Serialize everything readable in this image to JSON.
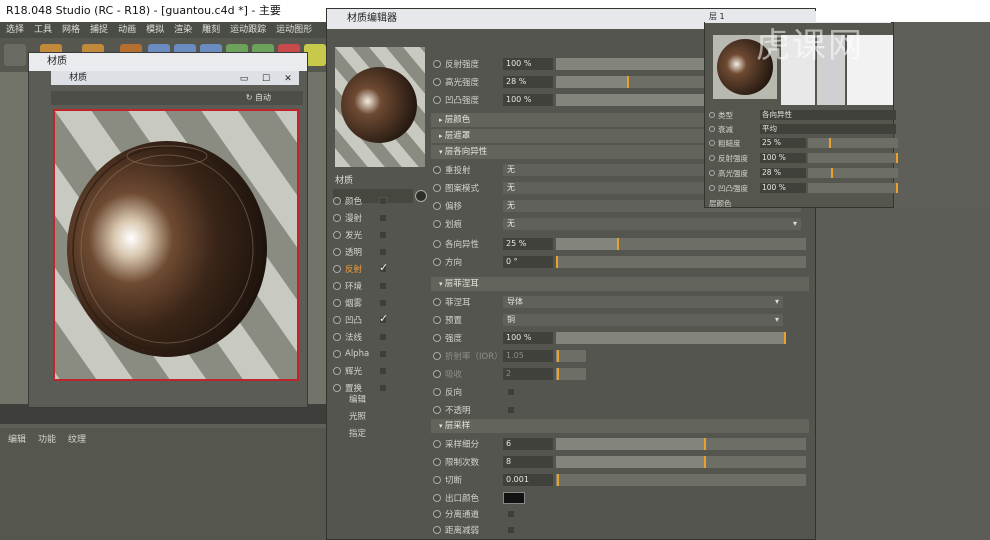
{
  "app": {
    "title": "R18.048 Studio (RC - R18) - [guantou.c4d *] - 主要",
    "menu": [
      "选择",
      "工具",
      "网格",
      "捕捉",
      "动画",
      "模拟",
      "渲染",
      "雕刻",
      "运动跟踪",
      "运动图形"
    ],
    "bottom_menu": [
      "编辑",
      "功能",
      "纹理"
    ]
  },
  "material_window": {
    "title": "材质",
    "inner_title": "材质",
    "refresh_label": "自动",
    "controls": {
      "minimize": "▭",
      "maximize": "☐",
      "close": "✕"
    }
  },
  "editor": {
    "title": "材质编辑器",
    "name_label": "材质",
    "channels": [
      {
        "label": "颜色",
        "checked": false,
        "active": false
      },
      {
        "label": "漫射",
        "checked": false,
        "active": false
      },
      {
        "label": "发光",
        "checked": false,
        "active": false
      },
      {
        "label": "透明",
        "checked": false,
        "active": false
      },
      {
        "label": "反射",
        "checked": true,
        "active": true
      },
      {
        "label": "环境",
        "checked": false,
        "active": false
      },
      {
        "label": "烟雾",
        "checked": false,
        "active": false
      },
      {
        "label": "凹凸",
        "checked": true,
        "active": false
      },
      {
        "label": "法线",
        "checked": false,
        "active": false
      },
      {
        "label": "Alpha",
        "checked": false,
        "active": false
      },
      {
        "label": "辉光",
        "checked": false,
        "active": false
      },
      {
        "label": "置换",
        "checked": false,
        "active": false
      }
    ],
    "plain_items": [
      "编辑",
      "光照",
      "指定"
    ],
    "top_rows": [
      {
        "label": "反射强度",
        "value": "100 %",
        "fill": 1.0
      },
      {
        "label": "高光强度",
        "value": "28 %",
        "fill": 0.28
      },
      {
        "label": "凹凸强度",
        "value": "100 %",
        "fill": 1.0
      }
    ],
    "sections": {
      "color": "层颜色",
      "mask": "层遮罩",
      "anisotropy": "层各向异性",
      "fresnel": "层菲涅耳",
      "sampling": "层采样"
    },
    "anisotropy": {
      "rows": [
        {
          "label": "重投射",
          "value": "无"
        },
        {
          "label": "图案模式",
          "value": "无"
        },
        {
          "label": "偏移",
          "value": "无"
        },
        {
          "label": "划痕",
          "value": "无"
        }
      ],
      "aniso": {
        "label": "各向异性",
        "value": "25 %",
        "fill": 0.25
      },
      "direction": {
        "label": "方向",
        "value": "0 °",
        "fill": 0.0
      }
    },
    "fresnel": {
      "mode": {
        "label": "菲涅耳",
        "value": "导体"
      },
      "preset": {
        "label": "预置",
        "value": "铜"
      },
      "strength": {
        "label": "强度",
        "value": "100 %",
        "fill": 1.0
      },
      "ior": {
        "label": "折射率（IOR）",
        "value": "1.05"
      },
      "absorb": {
        "label": "吸收",
        "value": "2"
      },
      "invert": "反向",
      "opaque": "不透明"
    },
    "sampling": {
      "subdiv": {
        "label": "采样细分",
        "value": "6",
        "fill": 0.6
      },
      "limit": {
        "label": "限制次数",
        "value": "8",
        "fill": 0.6
      },
      "cutoff": {
        "label": "切断",
        "value": "0.001",
        "fill": 0.01
      },
      "exit_color": "出口颜色",
      "separate": "分离通道",
      "distance": "距离减弱"
    }
  },
  "attributes": {
    "title": "层 1",
    "type": {
      "label": "类型",
      "value": "各向异性"
    },
    "attenuation": {
      "label": "衰减",
      "value": "平均"
    },
    "rows": [
      {
        "label": "粗糙度",
        "value": "25 %",
        "fill": 0.25
      },
      {
        "label": "反射强度",
        "value": "100 %",
        "fill": 1.0
      },
      {
        "label": "高光强度",
        "value": "28 %",
        "fill": 0.28
      },
      {
        "label": "凹凸强度",
        "value": "100 %",
        "fill": 1.0
      }
    ],
    "section": "层颜色"
  },
  "watermark": "虎课网"
}
